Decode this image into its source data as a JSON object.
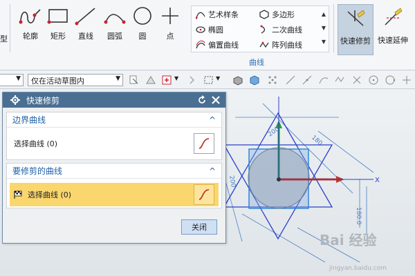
{
  "ribbon": {
    "left_cut_label": "型",
    "buttons": [
      {
        "label": "轮廓"
      },
      {
        "label": "矩形"
      },
      {
        "label": "直线"
      },
      {
        "label": "圆弧"
      },
      {
        "label": "圆"
      },
      {
        "label": "点"
      }
    ],
    "curve_items": {
      "art_spline": "艺术样条",
      "polygon": "多边形",
      "ellipse": "椭圆",
      "conic": "二次曲线",
      "offset_curve": "偏置曲线",
      "pattern_curve": "阵列曲线"
    },
    "group_label": "曲线",
    "quick_trim": "快速修剪",
    "quick_extend": "快速延伸"
  },
  "toolbar": {
    "selection_filter": "仅在活动草图内"
  },
  "dialog": {
    "title": "快速修剪",
    "section1": {
      "header": "边界曲线",
      "row_label": "选择曲线 (0)"
    },
    "section2": {
      "header": "要修剪的曲线",
      "row_label": "选择曲线 (0)"
    },
    "close_label": "关闭"
  },
  "scene": {
    "axis_x_label": "X",
    "dim_labels": [
      "200",
      "180",
      "180.0",
      "200"
    ]
  },
  "watermark": {
    "brand": "Bai 经验",
    "url": "jingyan.baidu.com"
  },
  "colors": {
    "dialog_title_bg": "#4a6f93",
    "active_row": "#fad66e",
    "section_header": "#1e5fa8",
    "sketch_blue": "#2a3fc9",
    "dimension_blue": "#4d7fc4"
  }
}
